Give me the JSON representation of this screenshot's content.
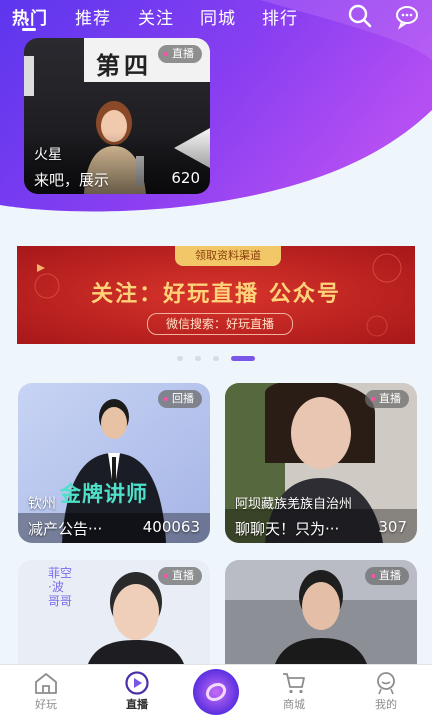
{
  "tabs": [
    {
      "label": "热门",
      "active": true
    },
    {
      "label": "推荐"
    },
    {
      "label": "关注"
    },
    {
      "label": "同城"
    },
    {
      "label": "排行"
    }
  ],
  "header_icons": [
    "search-icon",
    "message-icon"
  ],
  "featured_card": {
    "badge": "直播",
    "location": "火星",
    "title": "来吧，展示",
    "count": "620",
    "backdrop_text": "第四"
  },
  "banner": {
    "tag": "领取资料渠道",
    "main": "关注：好玩直播 公众号",
    "sub": "微信搜索：好玩直播"
  },
  "carousel": {
    "count": 4,
    "active_index": 3
  },
  "grid": [
    {
      "badge": "回播",
      "location": "钦州",
      "title": "减产公告···",
      "count": "400063",
      "overlay_text": "金牌讲师"
    },
    {
      "badge": "直播",
      "location": "阿坝藏族羌族自治州",
      "title": "聊聊天！只为···",
      "count": "307"
    },
    {
      "badge": "直播",
      "overlay_text": "菲空·波哥哥"
    },
    {
      "badge": "直播"
    }
  ],
  "bottom_nav": [
    {
      "label": "好玩",
      "icon": "home-icon"
    },
    {
      "label": "直播",
      "icon": "play-circle-icon",
      "active": true
    },
    {
      "label": "",
      "icon": "center-live-icon"
    },
    {
      "label": "商城",
      "icon": "cart-icon"
    },
    {
      "label": "我的",
      "icon": "profile-icon"
    }
  ],
  "colors": {
    "purple_start": "#6b3df0",
    "purple_end": "#b24cf2",
    "banner_red": "#c4241e",
    "accent": "#7a56e8"
  }
}
